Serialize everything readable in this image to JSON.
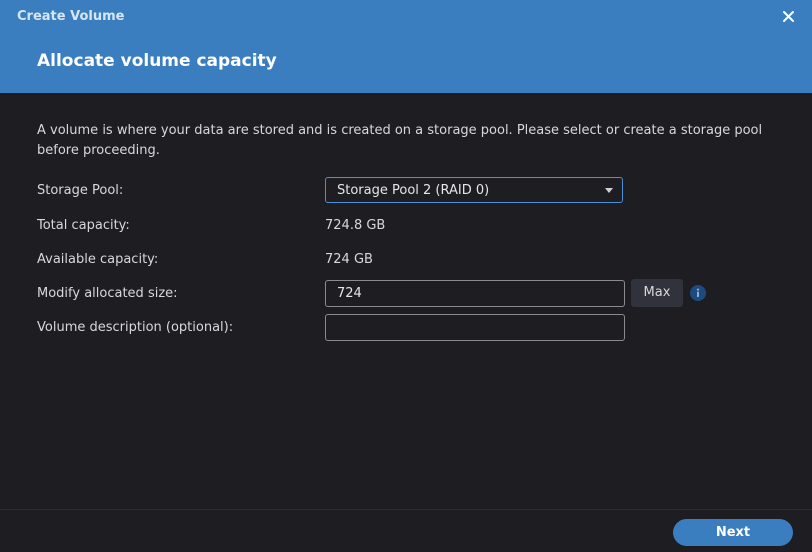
{
  "window": {
    "title": "Create Volume",
    "step_title": "Allocate volume capacity"
  },
  "description": "A volume is where your data are stored and is created on a storage pool. Please select or create a storage pool before proceeding.",
  "form": {
    "storage_pool_label": "Storage Pool:",
    "storage_pool_value": "Storage Pool 2 (RAID 0)",
    "total_capacity_label": "Total capacity:",
    "total_capacity_value": "724.8 GB",
    "available_capacity_label": "Available capacity:",
    "available_capacity_value": "724 GB",
    "allocated_size_label": "Modify allocated size:",
    "allocated_size_value": "724",
    "max_button_label": "Max",
    "description_label": "Volume description (optional):",
    "description_value": ""
  },
  "footer": {
    "next_label": "Next"
  },
  "icons": {
    "close": "close-icon",
    "info": "info-icon",
    "dropdown": "chevron-down-icon"
  },
  "colors": {
    "header_bg": "#3a7ec0",
    "body_bg": "#1d1d22",
    "accent": "#4d8fd4"
  }
}
